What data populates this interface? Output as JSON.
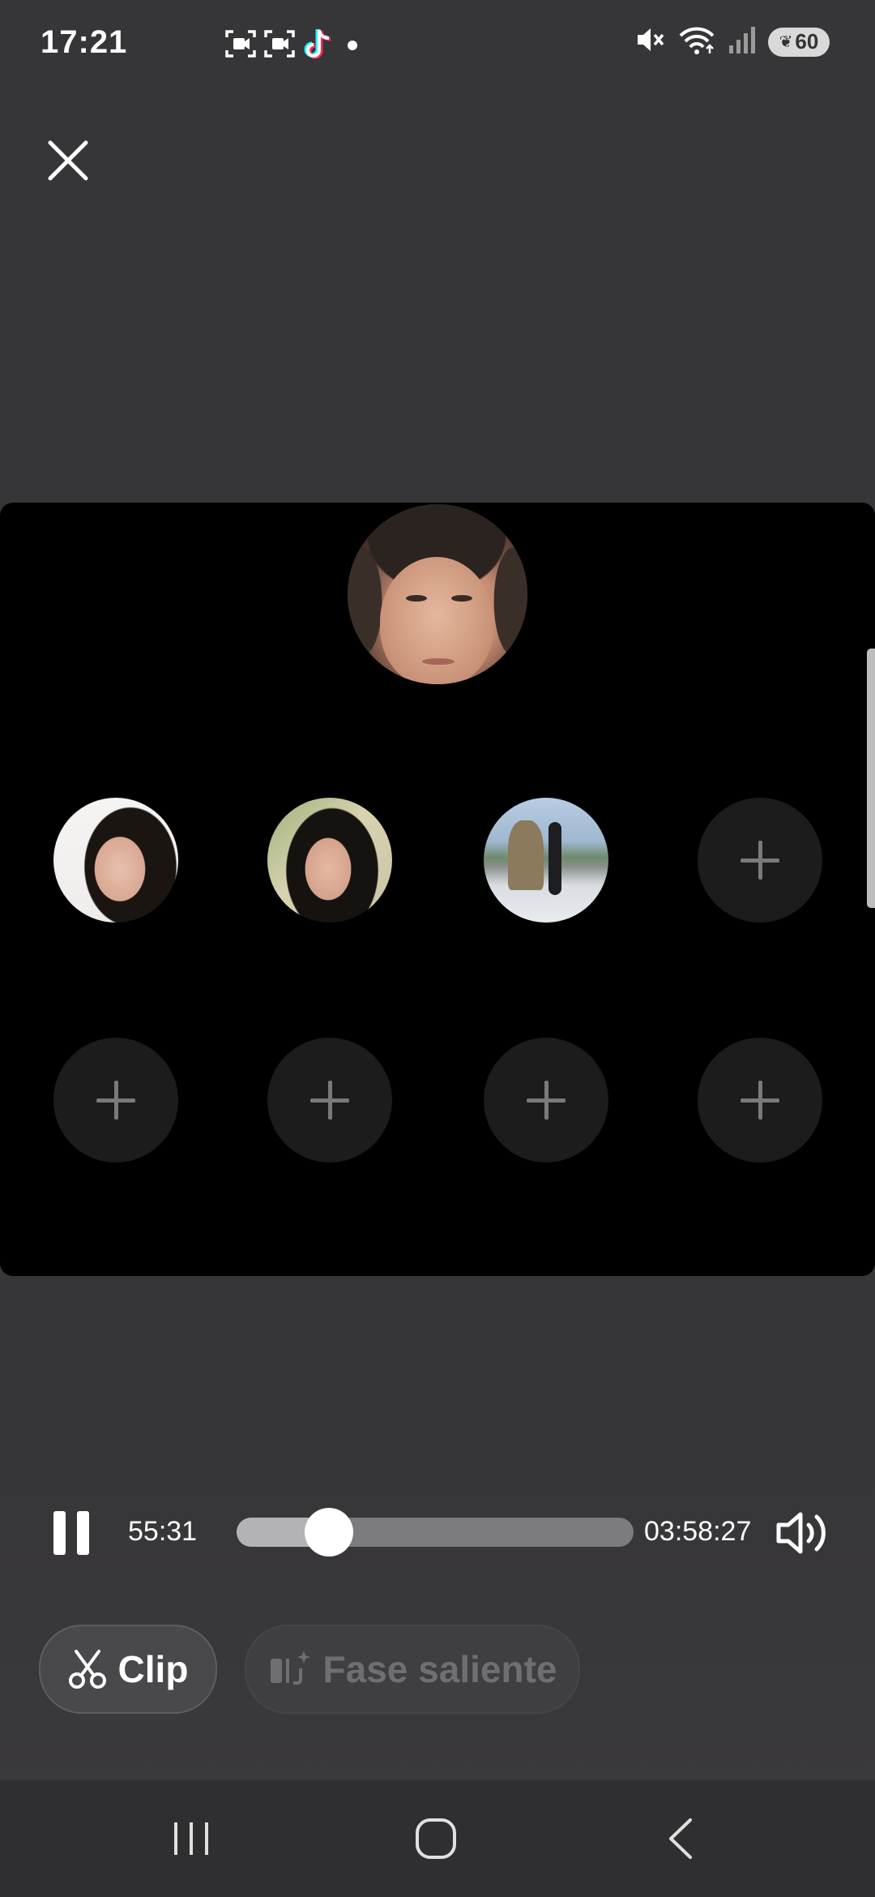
{
  "status_bar": {
    "time": "17:21",
    "battery_level": "60",
    "left_icons": [
      "screen-record-icon",
      "screen-record-icon",
      "tiktok-icon",
      "notification-dot-icon"
    ],
    "right_icons": [
      "mute-icon",
      "wifi-icon",
      "signal-icon",
      "battery-icon"
    ]
  },
  "header": {
    "close_icon": "close-icon"
  },
  "stage": {
    "host": {
      "avatar": "host-avatar"
    },
    "guests": [
      {
        "avatar": "guest-avatar-1",
        "filled": true
      },
      {
        "avatar": "guest-avatar-2",
        "filled": true
      },
      {
        "avatar": "guest-avatar-3",
        "filled": true
      },
      {
        "avatar": "empty-slot",
        "filled": false
      },
      {
        "avatar": "empty-slot",
        "filled": false
      },
      {
        "avatar": "empty-slot",
        "filled": false
      },
      {
        "avatar": "empty-slot",
        "filled": false
      },
      {
        "avatar": "empty-slot",
        "filled": false
      }
    ]
  },
  "player": {
    "current_time": "55:31",
    "total_time": "03:58:27",
    "progress_fraction": 0.232,
    "state": "playing"
  },
  "actions": {
    "clip_label": "Clip",
    "highlight_label": "Fase saliente"
  },
  "colors": {
    "background": "#363537",
    "stage": "#000000",
    "empty_slot": "#1c1c1d"
  }
}
